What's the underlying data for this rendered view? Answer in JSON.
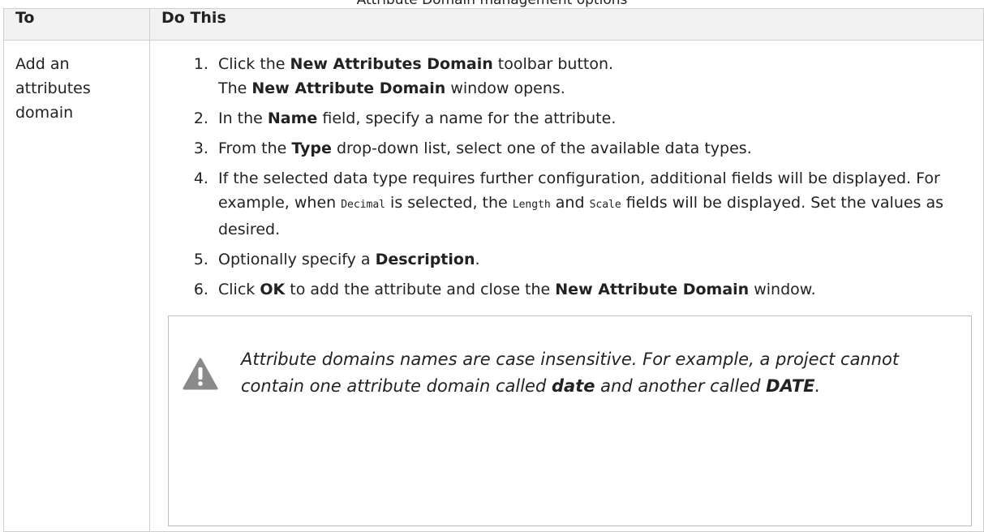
{
  "caption": "Attribute Domain management options",
  "table": {
    "headers": {
      "to": "To",
      "do_this": "Do This"
    },
    "row": {
      "to": "Add an attributes domain",
      "steps": [
        {
          "pre": "Click the ",
          "bold": "New Attributes Domain",
          "post": " toolbar button.",
          "sub_pre": "The ",
          "sub_bold": "New Attribute Domain",
          "sub_post": " window opens."
        },
        {
          "pre": "In the ",
          "bold": "Name",
          "post": " field, specify a name for the attribute."
        },
        {
          "pre": "From the ",
          "bold": "Type",
          "post": " drop-down list, select one of the available data types."
        },
        {
          "t1": "If the selected data type requires further configuration, additional fields will be displayed. For example, when ",
          "c1": "Decimal",
          "t2": " is selected, the ",
          "c2": "Length",
          "t3": " and ",
          "c3": "Scale",
          "t4": " fields will be displayed. Set the values as desired."
        },
        {
          "pre": "Optionally specify a ",
          "bold": "Description",
          "post": "."
        },
        {
          "pre": "Click ",
          "bold": "OK",
          "mid": " to add the attribute and close the ",
          "bold2": "New Attribute Domain",
          "post": " window."
        }
      ],
      "note": {
        "icon": "warning-icon",
        "pre": "Attribute domains names are case insensitive. For example, a project cannot contain one attribute domain called ",
        "b1": "date",
        "mid": " and another called ",
        "b2": "DATE",
        "post": "."
      }
    }
  },
  "colors": {
    "header_bg": "#f2f2f2",
    "border": "#cfcfcf",
    "warning_icon": "#8a8a8a"
  }
}
